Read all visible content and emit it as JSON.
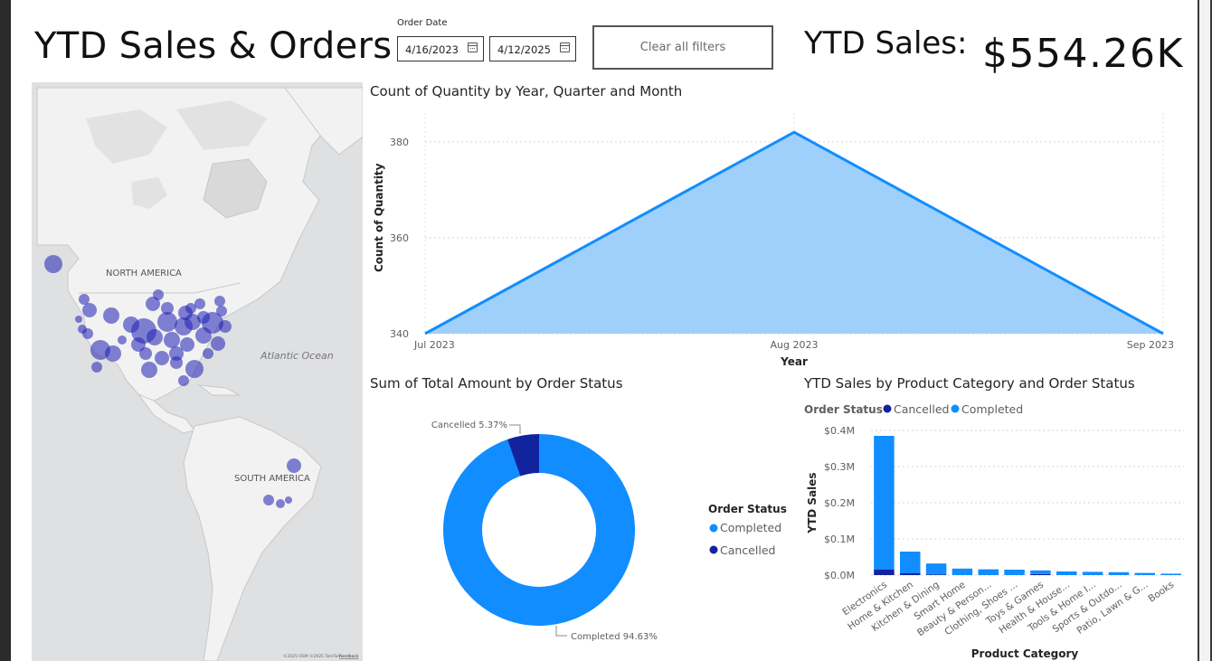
{
  "header": {
    "title": "YTD Sales & Orders",
    "order_date_label": "Order Date",
    "date_start": "4/16/2023",
    "date_end": "4/12/2025",
    "clear_button": "Clear all filters",
    "ytd_label": "YTD Sales:",
    "ytd_value": "$554.26K"
  },
  "map": {
    "label_north_america": "NORTH AMERICA",
    "label_south_america": "SOUTH AMERICA",
    "label_atlantic": "Atlantic Ocean",
    "attribution": "©2025 OSM ©2025 TomTom",
    "feedback": "Feedback",
    "bubble_color": "#1f1fb4"
  },
  "area_chart": {
    "title": "Count of Quantity by Year, Quarter and Month",
    "color_fill": "#9fd0fb",
    "color_line": "#118dff"
  },
  "donut_chart": {
    "title": "Sum of Total Amount by Order Status",
    "legend_title": "Order Status",
    "legend_completed": "Completed",
    "legend_cancelled": "Cancelled",
    "completed_color": "#118dff",
    "cancelled_color": "#12239e"
  },
  "bar_chart": {
    "title": "YTD Sales by Product Category and Order Status",
    "legend_title": "Order Status",
    "legend_cancelled": "Cancelled",
    "legend_completed": "Completed"
  },
  "chart_data": [
    {
      "type": "area",
      "title": "Count of Quantity by Year, Quarter and Month",
      "xlabel": "Year",
      "ylabel": "Count of Quantity",
      "categories": [
        "Jul 2023",
        "Aug 2023",
        "Sep 2023"
      ],
      "values": [
        340,
        382,
        340
      ],
      "yticks": [
        340,
        360,
        380
      ],
      "ylim": [
        340,
        386
      ],
      "grid": true
    },
    {
      "type": "pie",
      "title": "Sum of Total Amount by Order Status",
      "donut": true,
      "slices": [
        {
          "name": "Cancelled",
          "label": "Cancelled 5.37%",
          "value": 5.37
        },
        {
          "name": "Completed",
          "label": "Completed 94.63%",
          "value": 94.63
        }
      ],
      "legend": "right"
    },
    {
      "type": "bar",
      "stacked": true,
      "title": "YTD Sales by Product Category and Order Status",
      "xlabel": "Product Category",
      "ylabel": "YTD Sales",
      "yticks": [
        "$0.0M",
        "$0.1M",
        "$0.2M",
        "$0.3M",
        "$0.4M"
      ],
      "ytick_values": [
        0,
        0.1,
        0.2,
        0.3,
        0.4
      ],
      "ylim": [
        0,
        0.4
      ],
      "categories": [
        "Electronics",
        "Home & Kitchen",
        "Kitchen & Dining",
        "Smart Home",
        "Beauty & Person...",
        "Clothing, Shoes ...",
        "Toys & Games",
        "Health & House...",
        "Tools & Home I...",
        "Sports & Outdo...",
        "Patio, Lawn & G...",
        "Books"
      ],
      "series": [
        {
          "name": "Cancelled",
          "values": [
            0.015,
            0.005,
            0.002,
            0,
            0,
            0,
            0.003,
            0,
            0,
            0,
            0,
            0
          ]
        },
        {
          "name": "Completed",
          "values": [
            0.37,
            0.06,
            0.03,
            0.018,
            0.016,
            0.015,
            0.01,
            0.01,
            0.009,
            0.008,
            0.006,
            0.004
          ]
        }
      ],
      "legend": "top-left",
      "grid": true
    }
  ]
}
